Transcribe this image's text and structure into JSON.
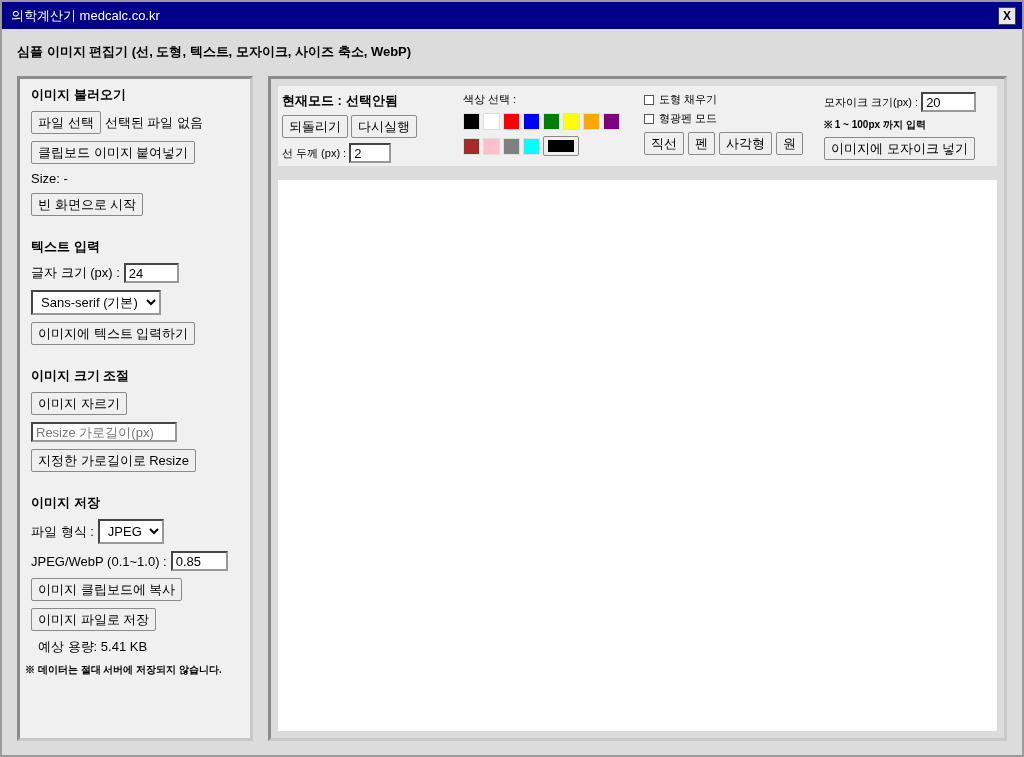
{
  "window": {
    "title": "의학계산기 medcalc.co.kr",
    "close_button": "X"
  },
  "heading": "심플 이미지 편집기 (선, 도형, 텍스트, 모자이크, 사이즈 축소, WebP)",
  "load_section": {
    "title": "이미지 불러오기",
    "file_button": "파일 선택",
    "file_status": "선택된 파일 없음",
    "paste_button": "클립보드 이미지 붙여넣기",
    "size_label": "Size: -",
    "blank_button": "빈 화면으로 시작"
  },
  "text_section": {
    "title": "텍스트 입력",
    "font_size_label": "글자 크기 (px) :",
    "font_size_value": "24",
    "font_select": "Sans-serif (기본)",
    "insert_button": "이미지에 텍스트 입력하기"
  },
  "resize_section": {
    "title": "이미지 크기 조절",
    "crop_button": "이미지 자르기",
    "width_placeholder": "Resize 가로길이(px)",
    "resize_button": "지정한 가로길이로 Resize"
  },
  "save_section": {
    "title": "이미지 저장",
    "format_label": "파일 형식 :",
    "format_value": "JPEG",
    "quality_label": "JPEG/WebP (0.1~1.0) :",
    "quality_value": "0.85",
    "copy_button": "이미지 클립보드에 복사",
    "save_button": "이미지 파일로 저장",
    "estimated_size": "예상 용량: 5.41 KB",
    "notice": "※ 데이터는 절대 서버에 저장되지 않습니다."
  },
  "toolbar": {
    "mode_label": "현재모드 : 선택안됨",
    "undo_button": "되돌리기",
    "redo_button": "다시실행",
    "line_width_label": "선 두께 (px) :",
    "line_width_value": "2",
    "color_label": "색상 선택 :",
    "colors": [
      {
        "color": "#000000"
      },
      {
        "color": "#ffffff"
      },
      {
        "color": "#ff0000"
      },
      {
        "color": "#0000ff"
      },
      {
        "color": "#008000"
      },
      {
        "color": "#ffff00"
      },
      {
        "color": "#ffa500"
      },
      {
        "color": "#800080"
      },
      {
        "color": "#a52a2a"
      },
      {
        "color": "#ffc0cb"
      },
      {
        "color": "#808080"
      },
      {
        "color": "#00ffff"
      }
    ],
    "color_picker": {
      "color": "#000000"
    },
    "checkboxes": [
      {
        "label": "도형 채우기",
        "checked": false
      },
      {
        "label": "형광펜 모드",
        "checked": false
      }
    ],
    "shape_buttons": [
      "직선",
      "펜",
      "사각형",
      "원"
    ],
    "mosaic_label": "모자이크 크기(px) :",
    "mosaic_value": "20",
    "mosaic_hint": "※ 1 ~ 100px 까지 입력",
    "mosaic_button": "이미지에 모자이크 넣기"
  }
}
